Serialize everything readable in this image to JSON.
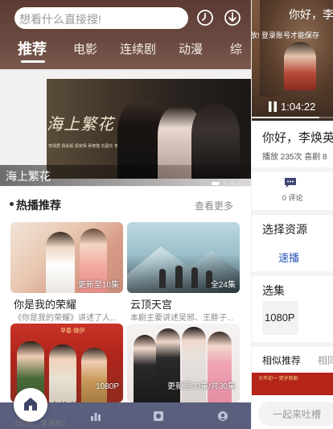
{
  "search": {
    "placeholder": "想看什么直接搜!"
  },
  "tabs": [
    {
      "label": "推荐"
    },
    {
      "label": "电影"
    },
    {
      "label": "连续剧"
    },
    {
      "label": "动漫"
    },
    {
      "label": "综"
    }
  ],
  "banner": {
    "title": "海上繁花",
    "art_title": "海上繁花",
    "art_subtitle": "李翊君 杨采妮 梁家辉 吴奇隆 刘嘉玲 李若彤 林心如 黄磊"
  },
  "section": {
    "title": "热播推荐",
    "more": "查看更多"
  },
  "cards": [
    {
      "title": "你是我的荣耀",
      "desc": "《你是我的荣耀》讲述了人...",
      "badge": "更新至10集"
    },
    {
      "title": "云顶天宫",
      "desc": "本剧主要讲述吴邪、王胖子...",
      "badge": "全24集"
    },
    {
      "title": "",
      "desc": "",
      "badge": "1080P",
      "art_text": "早春·微伊"
    },
    {
      "title": "",
      "desc": "",
      "badge": "更新至30集/共30集"
    }
  ],
  "peek": {
    "title": "李焕英",
    "sub": "《你好，李焕英》"
  },
  "player": {
    "video_title": "你好，李",
    "login_notice": "放! 登录账号才能保存",
    "time": "1:04:22",
    "progress": 0.82,
    "title": "你好，李焕英",
    "plays": "播放 235次  喜剧 8",
    "comments": "0 评论",
    "source_label": "选择资源",
    "source_value": "速播",
    "episodes_label": "选集",
    "episode": "1080P",
    "similar_label": "相似推荐",
    "similar_label2": "相同",
    "similar_thumb_text": "大年初一  贺岁新剧",
    "comment_placeholder": "一起来吐槽"
  },
  "colors": {
    "topbar": "#5b3b33",
    "navbar": "#5a5f7e",
    "link": "#2b59b8"
  }
}
